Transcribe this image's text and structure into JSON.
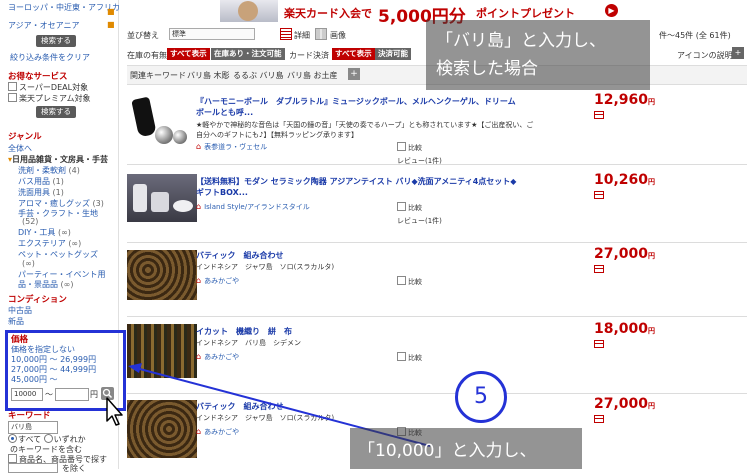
{
  "banner": {
    "text_big": "楽天カード入会で",
    "text_amount": "5,000円分",
    "text_tail": "ポイントプレゼント",
    "arrow": "▶"
  },
  "sidebar": {
    "region_links": [
      "ヨーロッパ・中近東・アフリカ",
      "アジア・オセアニア"
    ],
    "search_btn1": "検索する",
    "clear_link": "絞り込み条件をクリア",
    "service_head": "お得なサービス",
    "service_items": [
      "スーパーDEAL対象",
      "楽天プレミアム対象"
    ],
    "search_btn2": "検索する",
    "genre_head": "ジャンル",
    "genre_all": "全体へ",
    "genre_current": "日用品雑貨・文房具・手芸",
    "genre_items": [
      {
        "label": "洗剤・柔軟剤",
        "count": "(4)"
      },
      {
        "label": "バス用品",
        "count": "(1)"
      },
      {
        "label": "洗面用具",
        "count": "(1)"
      },
      {
        "label": "アロマ・癒しグッズ",
        "count": "(3)"
      },
      {
        "label": "手芸・クラフト・生地",
        "count": "(52)"
      },
      {
        "label": "DIY・工具",
        "count": "(∞)"
      },
      {
        "label": "エクステリア",
        "count": "(∞)"
      },
      {
        "label": "ペット・ペットグッズ",
        "count": "(∞)"
      },
      {
        "label": "パーティー・イベント用品・景品品",
        "count": "(∞)"
      }
    ],
    "condition_head": "コンディション",
    "condition_items": [
      "中古品",
      "新品"
    ],
    "price_head": "価格",
    "price_items": [
      "価格を指定しない",
      "10,000円 〜 26,999円",
      "27,000円 〜 44,999円",
      "45,000円 〜"
    ],
    "price_min": "10000",
    "price_tilde": "〜",
    "price_unit": "円",
    "keyword_head": "キーワード",
    "keyword_value": "バリ島",
    "kw_all": "すべて",
    "kw_any": "いずれか",
    "kw_include": "のキーワードを含む",
    "kw_name": "商品名、商品番号で探す",
    "kw_exclude": "を除く"
  },
  "toolbar": {
    "sort_label": "並び替え",
    "sort_value": "標準",
    "view_detail": "詳細",
    "view_image": "画像",
    "page_info": "件〜45件 (全 61件)",
    "icon_help": "アイコンの説明",
    "stock_label": "在庫の有無",
    "stock_all": "すべて表示",
    "stock_in": "在庫あり・注文可能",
    "card_label": "カード決済",
    "card_all": "すべて表示",
    "card_ok": "決済可能",
    "related_label": "関連キーワード",
    "related": [
      "バリ島 木彫",
      "るるぶ バリ島",
      "バリ島 お土産"
    ],
    "related_plus": "+"
  },
  "callout_top": {
    "line1": "「バリ島」と入力し、",
    "line2": "検索した場合"
  },
  "callout_bottom": {
    "line1": "「10,000」と入力し、"
  },
  "step_badge": "5",
  "results": [
    {
      "title1": "『ハーモニーボール　ダブルラトル』ミュージックボール、メルヘンクーゲル、ドリーム",
      "title2": "ボールとも呼...",
      "desc1": "★軽やかで神秘的な音色は「天国の鐘の音」「天使の奏でるハープ」とも称されています★【ご出産祝い、ご",
      "desc2": "自分へのギフトにも♪】【無料ラッピング承ります】",
      "shop": "表参道ラ・ヴェセル",
      "compare": "比較",
      "review": "レビュー(1件)",
      "price": "12,960",
      "yen": "円"
    },
    {
      "title1": "【送料無料】モダン セラミック陶器 アジアンテイスト バリ◆洗面アメニティ4点セット◆",
      "title2": "ギフトBOX...",
      "shop": "Island Style/アイランドスタイル",
      "compare": "比較",
      "review": "レビュー(1件)",
      "price": "10,260",
      "yen": "円"
    },
    {
      "title1": "バティック　組み合わせ",
      "desc1": "インドネシア　ジャワ島　ソロ(スラカルタ)",
      "shop": "あみかごや",
      "compare": "比較",
      "price": "27,000",
      "yen": "円"
    },
    {
      "title1": "イカット　機織り　絣　布",
      "desc1": "インドネシア　バリ島　シデメン",
      "shop": "あみかごや",
      "compare": "比較",
      "price": "18,000",
      "yen": "円"
    },
    {
      "title1": "バティック　組み合わせ",
      "desc1": "インドネシア　ジャワ島　ソロ(スラカルタ)",
      "shop": "あみかごや",
      "compare": "比較",
      "price": "27,000",
      "yen": "円"
    }
  ],
  "colors": {
    "accent_red": "#bf0000",
    "highlight_blue": "#2432d6",
    "link_blue": "#2a5db0"
  }
}
